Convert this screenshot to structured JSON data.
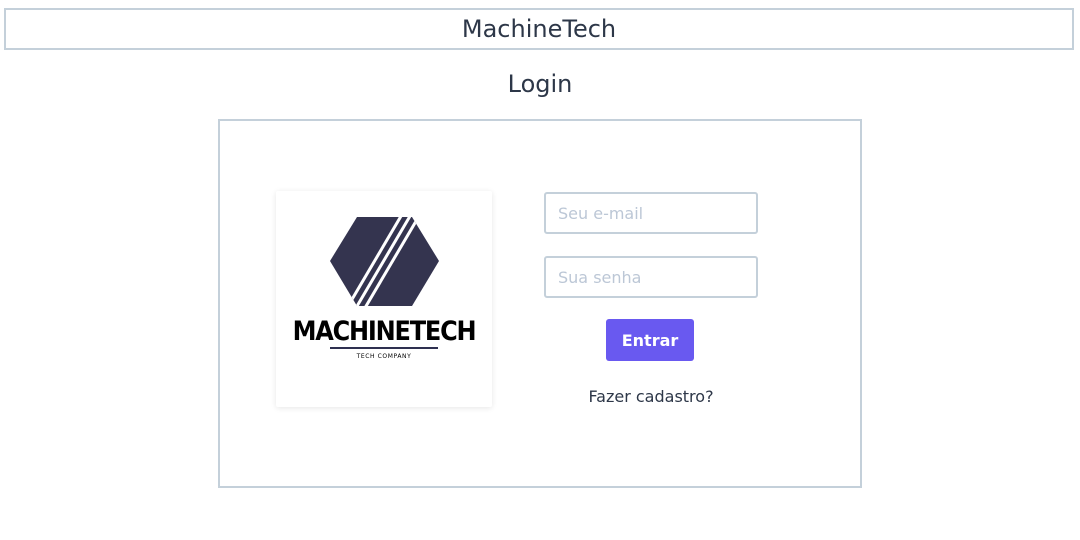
{
  "header": {
    "brand": "MachineTech"
  },
  "page": {
    "title": "Login"
  },
  "logo": {
    "wordmark": "MACHINETECH",
    "tagline": "TECH COMPANY",
    "color": "#34344f"
  },
  "form": {
    "email_placeholder": "Seu e-mail",
    "email_value": "",
    "password_placeholder": "Sua senha",
    "password_value": "",
    "submit_label": "Entrar",
    "register_link": "Fazer cadastro?"
  },
  "colors": {
    "accent": "#6959f0",
    "border": "#c4d0da",
    "text": "#2d3748",
    "placeholder": "#bcc7d6"
  },
  "icons": {
    "logo_mark": "hexagon-logo-icon"
  }
}
